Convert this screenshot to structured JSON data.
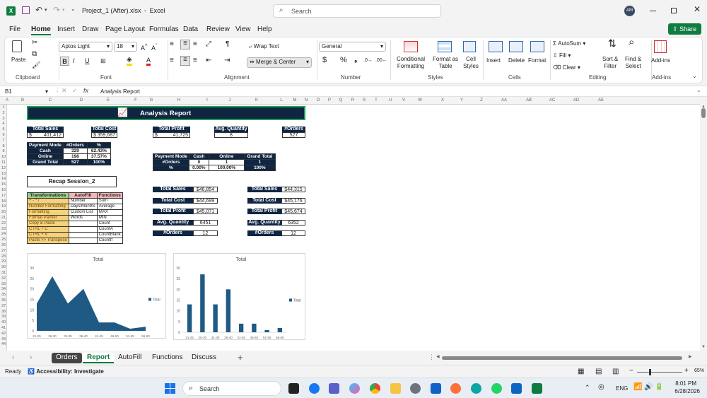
{
  "title": {
    "file": "Project_1 (After).xlsx",
    "sep": "-",
    "app": "Excel",
    "search_placeholder": "Search",
    "avatar": "AM"
  },
  "menu": [
    "File",
    "Home",
    "Insert",
    "Draw",
    "Page Layout",
    "Formulas",
    "Data",
    "Review",
    "View",
    "Help"
  ],
  "share": "Share",
  "ribbon": {
    "paste": "Paste",
    "clipboard": "Clipboard",
    "font_name": "Aptos Light",
    "font_size": "18",
    "font": "Font",
    "wrap": "Wrap Text",
    "merge": "Merge & Center",
    "alignment": "Alignment",
    "numfmt": "General",
    "number": "Number",
    "cond": [
      "Conditional",
      "Formatting"
    ],
    "fmt_table": [
      "Format as",
      "Table"
    ],
    "cell_styles": [
      "Cell",
      "Styles"
    ],
    "styles": "Styles",
    "insert": "Insert",
    "delete": "Delete",
    "format": "Format",
    "cells": "Cells",
    "autosum": "AutoSum",
    "fill": "Fill",
    "clear": "Clear",
    "sort": [
      "Sort &",
      "Filter"
    ],
    "find": [
      "Find &",
      "Select"
    ],
    "editing": "Editing",
    "addins": "Add-ins",
    "addins_grp": "Add-ins"
  },
  "formula": {
    "namebox": "B1",
    "fx": "fx",
    "content": "Analysis Report"
  },
  "columns": [
    "A",
    "B",
    "C",
    "D",
    "E",
    "F",
    "G",
    "H",
    "I",
    "J",
    "K",
    "L",
    "M",
    "N",
    "O",
    "P",
    "Q",
    "R",
    "S",
    "T",
    "U",
    "V",
    "W",
    "X",
    "Y",
    "Z",
    "AA",
    "AB",
    "AC",
    "AD",
    "AE"
  ],
  "sheet": {
    "report_title": "Analysis Report",
    "kpi_left": [
      {
        "label": "Total Sales",
        "cur": "$",
        "value": "401,412"
      },
      {
        "label": "Total Cost",
        "cur": "$",
        "value": "359,687"
      },
      {
        "label": "Total Profit",
        "cur": "$",
        "value": "41,725"
      },
      {
        "label": "Avg. Quantity",
        "cur": "",
        "value": "8"
      },
      {
        "label": "#Orders",
        "cur": "",
        "value": "527"
      }
    ],
    "payment": {
      "headers": [
        "Payment Mode",
        "#Orders",
        "%"
      ],
      "rows": [
        [
          "Cash",
          "329",
          "62.43%"
        ],
        [
          "Online",
          "198",
          "37.57%"
        ],
        [
          "Grand Total",
          "527",
          "100%"
        ]
      ]
    },
    "payment2": {
      "headers": [
        "Payment Mode",
        "Cash",
        "Online",
        "Grand Total"
      ],
      "rows": [
        [
          "#Orders",
          "0",
          "1",
          "1"
        ],
        [
          "%",
          "0.00%",
          "100.00%",
          "100%"
        ]
      ]
    },
    "recap": "Recap Session_2",
    "recap_table": {
      "headers": [
        "Transformations",
        "AutoFill",
        "Functions"
      ],
      "rows": [
        [
          "+ - * /",
          "Number",
          "Sum"
        ],
        [
          "Number Formatting",
          "Days/Months",
          "Average"
        ],
        [
          "Formatting",
          "Custom List",
          "MAX"
        ],
        [
          "Format Painter",
          "Words",
          "MIN"
        ],
        [
          "Copy & Paste",
          "",
          "Count"
        ],
        [
          "CTRL + C",
          "",
          "CountA"
        ],
        [
          "CTRL + V",
          "",
          "CountBlank"
        ],
        [
          "Paste >> Transpose",
          "",
          "CountIf"
        ]
      ]
    },
    "mid_kpi": [
      {
        "label": "Total Sales",
        "value": "$46,854"
      },
      {
        "label": "Total Cost",
        "value": "$44,699"
      },
      {
        "label": "Total Profit",
        "value": "$45,071"
      },
      {
        "label": "Avg. Quantity",
        "value": "6451"
      },
      {
        "label": "#Orders",
        "value": "12"
      }
    ],
    "right_kpi": [
      {
        "label": "Total Sales",
        "value": "$44,315"
      },
      {
        "label": "Total Cost",
        "value": "$45,176"
      },
      {
        "label": "Total Profit",
        "value": "$45,674"
      },
      {
        "label": "Avg. Quantity",
        "value": "6352"
      },
      {
        "label": "#Orders",
        "value": "12"
      }
    ]
  },
  "chart_data": [
    {
      "type": "area",
      "title": "Total",
      "categories": [
        "21-25",
        "26-30",
        "31-35",
        "36-40",
        "41-45",
        "46-50",
        "51-55",
        "56-60"
      ],
      "series": [
        {
          "name": "Total",
          "values": [
            13,
            26,
            13,
            20,
            4,
            4,
            1,
            2
          ]
        }
      ],
      "ylim": [
        0,
        30
      ],
      "yticks": [
        0,
        5,
        10,
        15,
        20,
        25,
        30
      ],
      "legend": "right",
      "color": "#1e5a84"
    },
    {
      "type": "bar",
      "title": "Total",
      "categories": [
        "21-25",
        "26-30",
        "31-35",
        "36-40",
        "41-45",
        "46-50",
        "51-55",
        "56-60"
      ],
      "series": [
        {
          "name": "Total",
          "values": [
            13,
            27,
            13,
            20,
            4,
            4,
            1,
            2
          ]
        }
      ],
      "ylim": [
        0,
        30
      ],
      "yticks": [
        0,
        5,
        10,
        15,
        20,
        25,
        30
      ],
      "legend": "right",
      "color": "#1e5a84"
    }
  ],
  "tabs": [
    "Orders",
    "Report",
    "AutoFill",
    "Functions",
    "Discuss"
  ],
  "active_tab": "Report",
  "status": {
    "ready": "Ready",
    "access": "Accessibility: Investigate",
    "zoom": "65%"
  },
  "taskbar": {
    "search": "Search",
    "lang": "ENG",
    "time": "8:01 PM",
    "date": "6/28/2026"
  }
}
